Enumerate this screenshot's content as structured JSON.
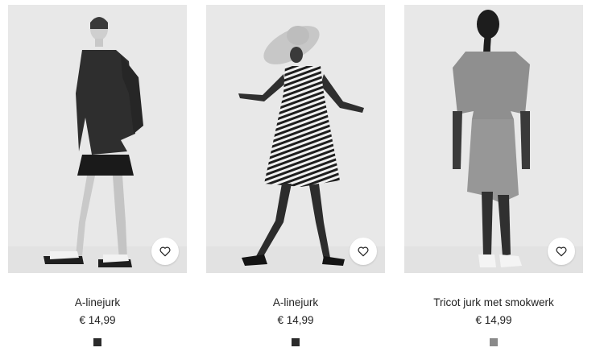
{
  "products": [
    {
      "name": "A-linejurk",
      "price": "€ 14,99",
      "swatch_color": "#2b2b2b",
      "favorite_icon": "heart-outline-icon"
    },
    {
      "name": "A-linejurk",
      "price": "€ 14,99",
      "swatch_color": "#2b2b2b",
      "favorite_icon": "heart-outline-icon"
    },
    {
      "name": "Tricot jurk met smokwerk",
      "price": "€ 14,99",
      "swatch_color": "#8a8a8a",
      "favorite_icon": "heart-outline-icon"
    }
  ]
}
